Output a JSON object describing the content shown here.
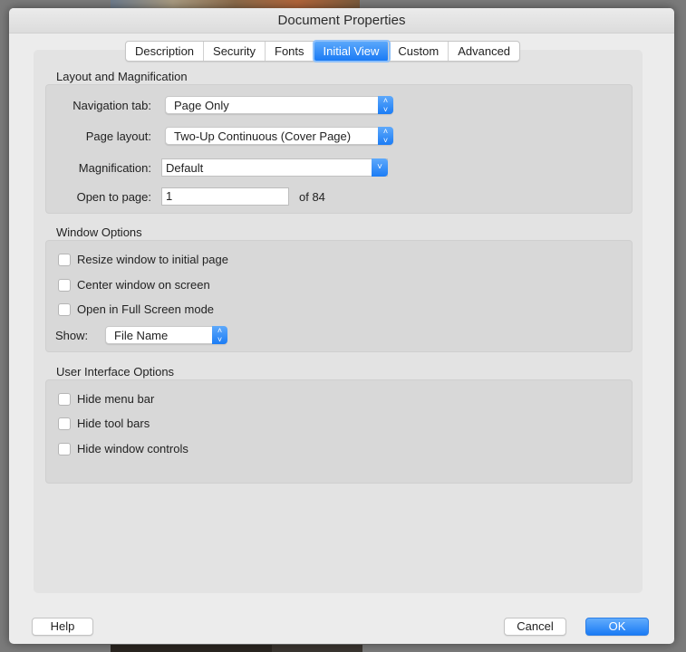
{
  "dialog": {
    "title": "Document Properties",
    "tabs": [
      {
        "label": "Description",
        "active": false
      },
      {
        "label": "Security",
        "active": false
      },
      {
        "label": "Fonts",
        "active": false
      },
      {
        "label": "Initial View",
        "active": true
      },
      {
        "label": "Custom",
        "active": false
      },
      {
        "label": "Advanced",
        "active": false
      }
    ],
    "accent_color": "#1a7bf5"
  },
  "layout_magnification": {
    "title": "Layout and Magnification",
    "navigation_tab": {
      "label": "Navigation tab:",
      "value": "Page Only"
    },
    "page_layout": {
      "label": "Page layout:",
      "value": "Two-Up Continuous (Cover Page)"
    },
    "magnification": {
      "label": "Magnification:",
      "value": "Default"
    },
    "open_to_page": {
      "label": "Open to page:",
      "value": "1",
      "of_label": "of 84"
    }
  },
  "window_options": {
    "title": "Window Options",
    "checkboxes": [
      {
        "label": "Resize window to initial page",
        "checked": false
      },
      {
        "label": "Center window on screen",
        "checked": false
      },
      {
        "label": "Open in Full Screen mode",
        "checked": false
      }
    ],
    "show": {
      "label": "Show:",
      "value": "File Name"
    }
  },
  "ui_options": {
    "title": "User Interface Options",
    "checkboxes": [
      {
        "label": "Hide menu bar",
        "checked": false
      },
      {
        "label": "Hide tool bars",
        "checked": false
      },
      {
        "label": "Hide window controls",
        "checked": false
      }
    ]
  },
  "footer": {
    "help_label": "Help",
    "cancel_label": "Cancel",
    "ok_label": "OK"
  }
}
